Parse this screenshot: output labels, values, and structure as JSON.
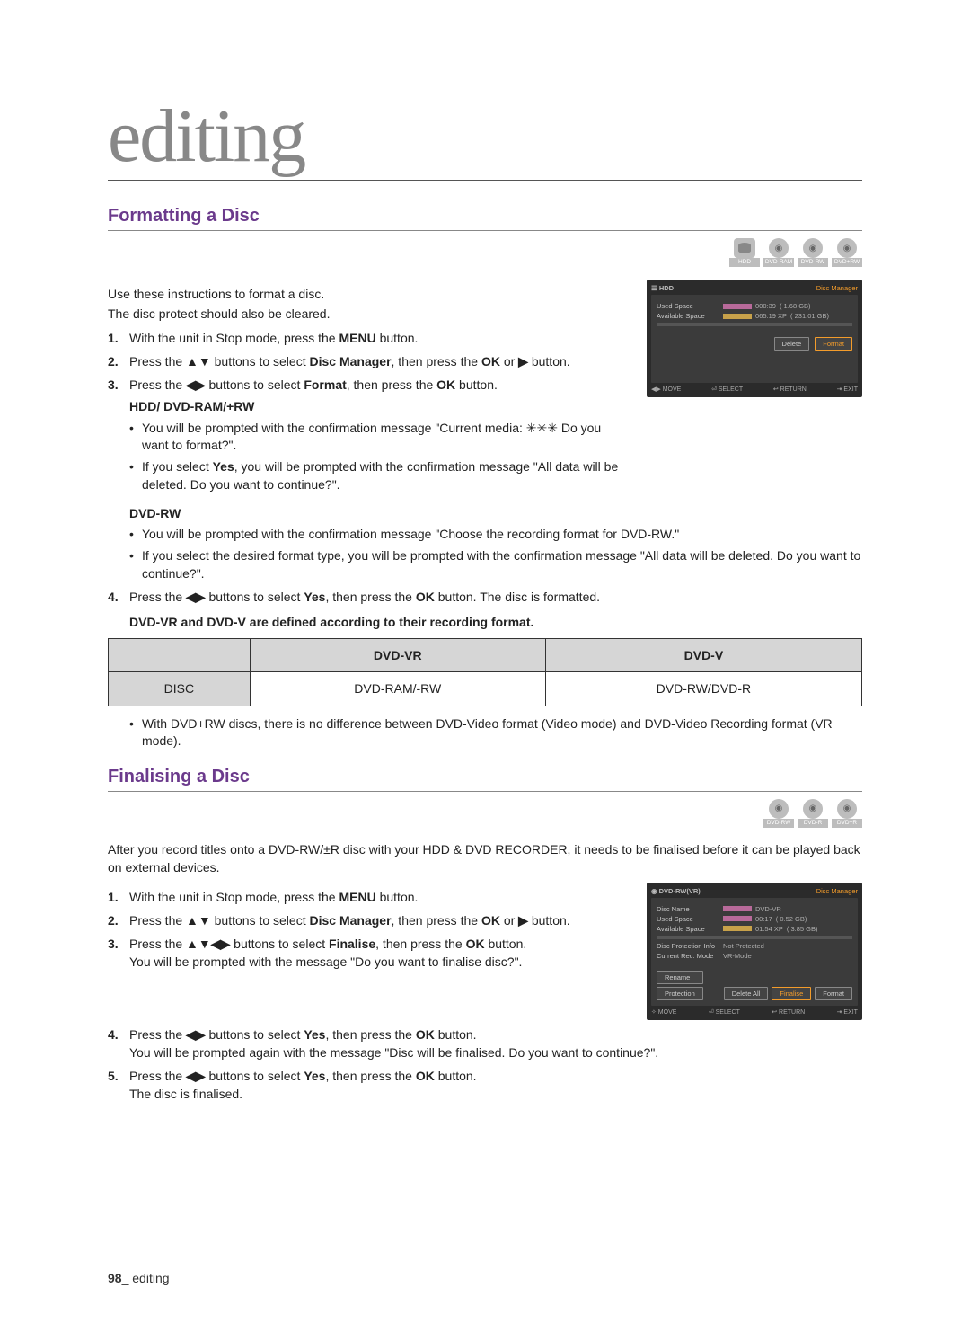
{
  "chapter": "editing",
  "section1": {
    "title": "Formatting a Disc",
    "media": [
      "HDD",
      "DVD-RAM",
      "DVD-RW",
      "DVD+RW"
    ],
    "intro1": "Use these instructions to format a disc.",
    "intro2": "The disc protect should also be cleared.",
    "step1_pre": "With the unit in Stop mode, press the ",
    "step1_menu": "MENU",
    "step1_post": " button.",
    "step2_a": "Press the ",
    "step2_arrows": "▲▼",
    "step2_b": " buttons to select ",
    "step2_dm": "Disc Manager",
    "step2_c": ", then press the ",
    "step2_ok": "OK",
    "step2_d": " or ",
    "step2_right": "▶",
    "step2_e": " button.",
    "step3_a": "Press the ",
    "step3_arrows": "◀▶",
    "step3_b": " buttons to select ",
    "step3_fmt": "Format",
    "step3_c": ", then press the ",
    "step3_ok": "OK",
    "step3_d": " button.",
    "sub_hdd": "HDD/ DVD-RAM/+RW",
    "hdd_b1": "You will be prompted with the confirmation message \"Current media: ✳✳✳ Do you want to format?\".",
    "hdd_b2a": "If you select ",
    "hdd_b2yes": "Yes",
    "hdd_b2b": ", you will be prompted with the confirmation message \"All data will be deleted. Do you want to continue?\".",
    "sub_rw": "DVD-RW",
    "rw_b1": "You will be prompted with the confirmation message \"Choose the recording format for DVD-RW.\"",
    "rw_b2": "If you select the desired format type, you will be prompted with the confirmation message \"All data will be deleted. Do you want to continue?\".",
    "step4_a": "Press the ",
    "step4_arrows": "◀▶",
    "step4_b": " buttons to select ",
    "step4_yes": "Yes",
    "step4_c": ", then press the ",
    "step4_ok": "OK",
    "step4_d": " button. The disc is formatted.",
    "note": "DVD-VR and DVD-V are defined according to their recording format.",
    "table": {
      "h1": "",
      "h2": "DVD-VR",
      "h3": "DVD-V",
      "r1c1": "DISC",
      "r1c2": "DVD-RAM/-RW",
      "r1c3": "DVD-RW/DVD-R"
    },
    "postnote": "With DVD+RW discs, there is no difference between DVD-Video format (Video mode) and DVD-Video Recording format (VR mode).",
    "screenshot": {
      "title_left": "HDD",
      "title_right": "Disc Manager",
      "rows": [
        {
          "label": "Used Space",
          "bar": "pink",
          "time": "000:39",
          "size": "(   1.68 GB)"
        },
        {
          "label": "Available Space",
          "bar": "yellow",
          "time": "065:19 XP",
          "size": "( 231.01 GB)"
        }
      ],
      "buttons": [
        {
          "text": "Delete",
          "sel": false
        },
        {
          "text": "Format",
          "sel": true
        }
      ],
      "foot": [
        "◀▶ MOVE",
        "⏎ SELECT",
        "↩ RETURN",
        "⇥ EXIT"
      ]
    }
  },
  "section2": {
    "title": "Finalising a Disc",
    "media": [
      "DVD-RW",
      "DVD-R",
      "DVD+R"
    ],
    "intro": "After you record titles onto a DVD-RW/±R disc with your HDD & DVD RECORDER, it needs to be finalised before it can be played back on external devices.",
    "step1_pre": "With the unit in Stop mode, press the ",
    "step1_menu": "MENU",
    "step1_post": " button.",
    "step2_a": "Press the ",
    "step2_arrows": "▲▼",
    "step2_b": " buttons to select ",
    "step2_dm": "Disc Manager",
    "step2_c": ", then press the ",
    "step2_ok": "OK",
    "step2_d": " or ",
    "step2_right": "▶",
    "step2_e": " button.",
    "step3_a": "Press the ",
    "step3_arrows": "▲▼◀▶",
    "step3_b": " buttons to select ",
    "step3_fin": "Finalise",
    "step3_c": ", then press the ",
    "step3_ok": "OK",
    "step3_d": " button.",
    "step3_prompt": "You will be prompted with the message \"Do you want to finalise disc?\".",
    "step4_a": "Press the ",
    "step4_arrows": "◀▶",
    "step4_b": " buttons to select ",
    "step4_yes": "Yes",
    "step4_c": ", then press the ",
    "step4_ok": "OK",
    "step4_d": " button.",
    "step4_prompt": "You will be prompted again with the message \"Disc will be finalised. Do you want to continue?\".",
    "step5_a": "Press the ",
    "step5_arrows": "◀▶",
    "step5_b": " buttons to select ",
    "step5_yes": "Yes",
    "step5_c": ", then press the ",
    "step5_ok": "OK",
    "step5_d": " button.",
    "step5_final": "The disc is finalised.",
    "screenshot": {
      "title_left": "DVD-RW(VR)",
      "title_right": "Disc Manager",
      "rows": [
        {
          "label": "Disc Name",
          "bar": "pink",
          "time": "DVD-VR",
          "size": ""
        },
        {
          "label": "Used Space",
          "bar": "pink",
          "time": "00:17",
          "size": "(  0.52 GB)"
        },
        {
          "label": "Available Space",
          "bar": "yellow",
          "time": "01:54 XP",
          "size": "(  3.85 GB)"
        },
        {
          "label": "Disc Protection Info",
          "bar": "",
          "time": "Not Protected",
          "size": ""
        },
        {
          "label": "Current Rec. Mode",
          "bar": "",
          "time": "VR-Mode",
          "size": ""
        }
      ],
      "side_buttons": [
        "Rename",
        "Protection"
      ],
      "buttons": [
        {
          "text": "Delete All",
          "sel": false
        },
        {
          "text": "Finalise",
          "sel": true
        },
        {
          "text": "Format",
          "sel": false
        }
      ],
      "foot": [
        "✧ MOVE",
        "⏎ SELECT",
        "↩ RETURN",
        "⇥ EXIT"
      ]
    }
  },
  "footer": {
    "page": "98",
    "label": "editing"
  }
}
